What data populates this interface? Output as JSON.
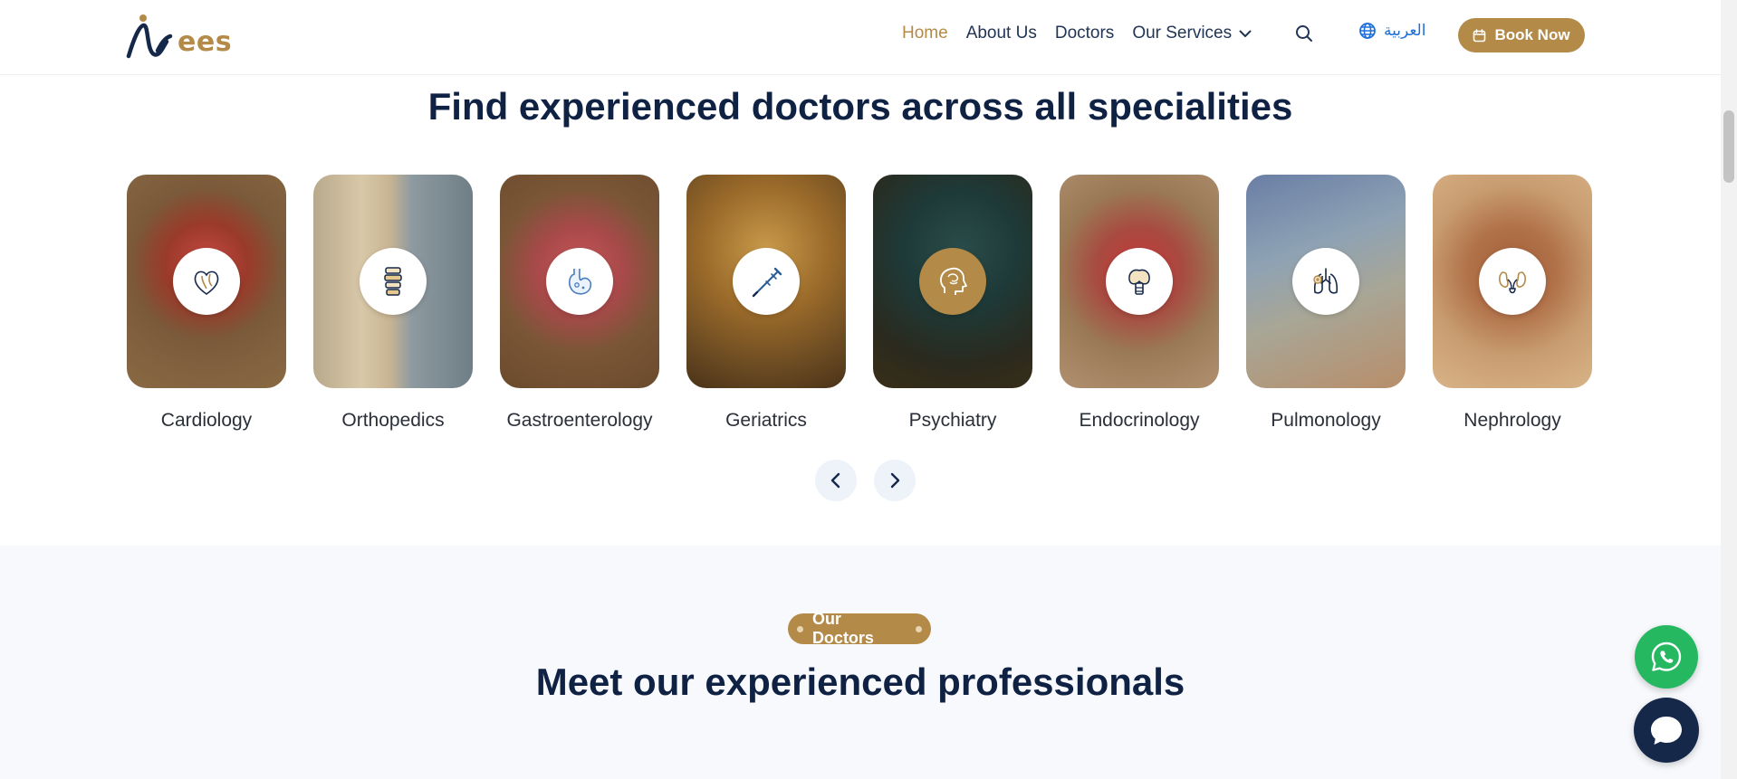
{
  "header": {
    "logo_text": "ees",
    "nav": [
      {
        "label": "Home",
        "active": true
      },
      {
        "label": "About Us",
        "active": false
      },
      {
        "label": "Doctors",
        "active": false
      },
      {
        "label": "Our Services",
        "active": false,
        "has_dropdown": true
      }
    ],
    "search_icon": "search-icon",
    "language_label": "العربية",
    "book_now_label": "Book Now"
  },
  "specialities": {
    "title": "Find experienced doctors across all specialities",
    "cards": [
      {
        "label": "Cardiology",
        "icon": "heart-icon"
      },
      {
        "label": "Orthopedics",
        "icon": "spine-icon"
      },
      {
        "label": "Gastroenterology",
        "icon": "stomach-icon"
      },
      {
        "label": "Geriatrics",
        "icon": "crutch-icon"
      },
      {
        "label": "Psychiatry",
        "icon": "brain-head-icon"
      },
      {
        "label": "Endocrinology",
        "icon": "thyroid-icon"
      },
      {
        "label": "Pulmonology",
        "icon": "lungs-icon"
      },
      {
        "label": "Nephrology",
        "icon": "kidneys-icon"
      }
    ],
    "prev_icon": "chevron-left-icon",
    "next_icon": "chevron-right-icon"
  },
  "doctors": {
    "badge": "Our Doctors",
    "title": "Meet our experienced professionals"
  },
  "floating": {
    "whatsapp_icon": "whatsapp-icon",
    "chat_icon": "chat-bubble-icon"
  },
  "colors": {
    "brand_gold": "#b38a47",
    "navy": "#0f2244",
    "whatsapp_green": "#25b860",
    "link_blue": "#1e6fd9"
  }
}
